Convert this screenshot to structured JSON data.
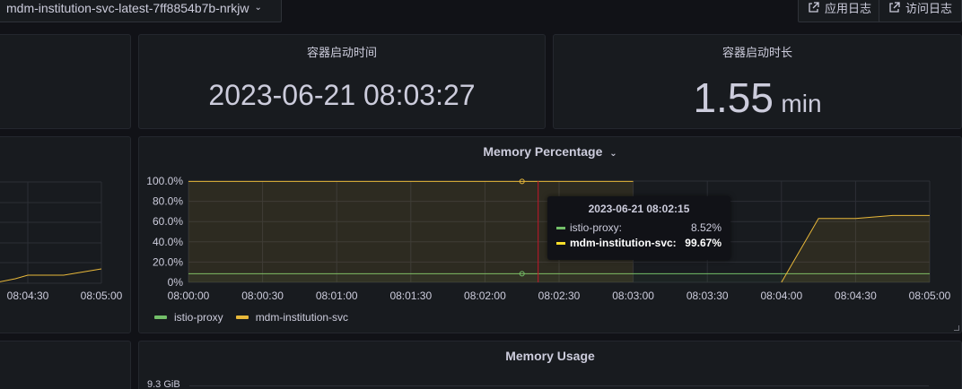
{
  "topbar": {
    "pod_selector": "mdm-institution-svc-latest-7ff8854b7b-nrkjw",
    "buttons": [
      "应用日志",
      "访问日志"
    ]
  },
  "panels": {
    "start_time": {
      "title": "容器启动时间",
      "value": "2023-06-21 08:03:27"
    },
    "uptime": {
      "title": "容器启动时长",
      "value": "1.55",
      "unit": "min"
    },
    "memory_percentage": {
      "title": "Memory Percentage"
    },
    "memory_usage": {
      "title": "Memory Usage",
      "first_tick": "9.3 GiB"
    }
  },
  "left_chart": {
    "x_ticks": [
      "08:04:30",
      "08:05:00"
    ]
  },
  "tooltip": {
    "time": "2023-06-21 08:02:15",
    "rows": [
      {
        "name": "istio-proxy:",
        "value": "8.52%",
        "color": "#73bf69"
      },
      {
        "name": "mdm-institution-svc:",
        "value": "99.67%",
        "color": "#fade2a"
      }
    ]
  },
  "colors": {
    "istio": "#73bf69",
    "mdm": "#e8b83a",
    "cursor": "#c4162a"
  },
  "chart_data": {
    "type": "line",
    "title": "Memory Percentage",
    "x": [
      "08:00:00",
      "08:00:15",
      "08:00:30",
      "08:00:45",
      "08:01:00",
      "08:01:15",
      "08:01:30",
      "08:01:45",
      "08:02:00",
      "08:02:15",
      "08:02:30",
      "08:02:45",
      "08:03:00",
      "08:03:15",
      "08:03:30",
      "08:03:45",
      "08:04:00",
      "08:04:15",
      "08:04:30",
      "08:04:45",
      "08:05:00"
    ],
    "x_ticks": [
      "08:00:00",
      "08:00:30",
      "08:01:00",
      "08:01:30",
      "08:02:00",
      "08:02:30",
      "08:03:00",
      "08:03:30",
      "08:04:00",
      "08:04:30",
      "08:05:00"
    ],
    "y_ticks": [
      "0%",
      "20.0%",
      "40.0%",
      "60.0%",
      "80.0%",
      "100.0%"
    ],
    "ylim": [
      0,
      100
    ],
    "series": [
      {
        "name": "istio-proxy",
        "values": [
          8.52,
          8.52,
          8.52,
          8.52,
          8.52,
          8.52,
          8.52,
          8.52,
          8.52,
          8.52,
          8.52,
          8.52,
          8.52,
          8.52,
          8.52,
          8.52,
          8.52,
          8.52,
          8.52,
          8.52,
          8.52
        ]
      },
      {
        "name": "mdm-institution-svc",
        "values": [
          99.67,
          99.67,
          99.67,
          99.67,
          99.67,
          99.67,
          99.67,
          99.67,
          99.67,
          99.67,
          99.67,
          99.67,
          99.67,
          null,
          null,
          null,
          0,
          63,
          63,
          66,
          66
        ]
      }
    ],
    "legend": "bottom-left",
    "grid": true
  }
}
